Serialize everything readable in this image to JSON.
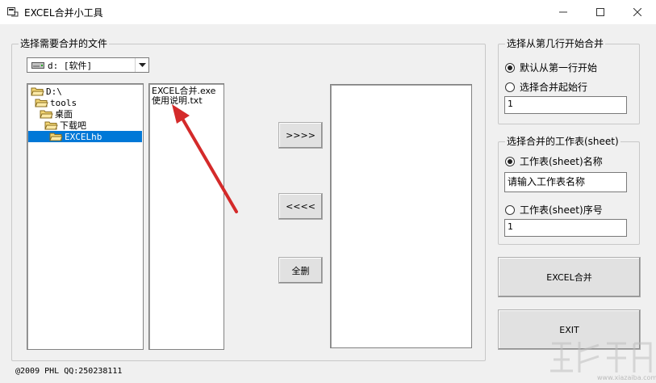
{
  "window": {
    "title": "EXCEL合并小工具"
  },
  "left_group": {
    "label": "选择需要合并的文件",
    "drive_select": "d: [软件]",
    "tree": [
      {
        "label": "D:\\",
        "selected": false
      },
      {
        "label": "tools",
        "selected": false
      },
      {
        "label": "桌面",
        "selected": false
      },
      {
        "label": "下载吧",
        "selected": false
      },
      {
        "label": "EXCELhb",
        "selected": true
      }
    ],
    "files": [
      "EXCEL合并.exe",
      "使用说明.txt"
    ],
    "buttons": {
      "add": ">>>>",
      "remove": "<<<<",
      "delete_all": "全删"
    }
  },
  "start_row_group": {
    "label": "选择从第几行开始合并",
    "option_default": "默认从第一行开始",
    "option_custom": "选择合并起始行",
    "row_value": "1"
  },
  "sheet_group": {
    "label": "选择合并的工作表(sheet)",
    "option_name": "工作表(sheet)名称",
    "name_value": "请输入工作表名称",
    "option_index": "工作表(sheet)序号",
    "index_value": "1"
  },
  "actions": {
    "merge": "EXCEL合并",
    "exit": "EXIT"
  },
  "footer": "@2009 PHL QQ:250238111",
  "watermark": "www.xiazaiba.com",
  "colors": {
    "selection": "#0078d7",
    "arrow": "#d42a2a"
  }
}
